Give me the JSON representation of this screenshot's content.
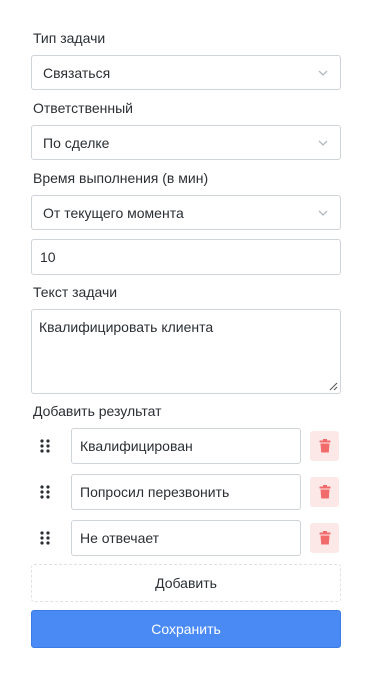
{
  "task_type": {
    "label": "Тип задачи",
    "value": "Связаться"
  },
  "responsible": {
    "label": "Ответственный",
    "value": "По сделке"
  },
  "due_time": {
    "label": "Время выполнения (в мин)",
    "mode": "От текущего момента",
    "minutes": "10"
  },
  "task_text": {
    "label": "Текст задачи",
    "value": "Квалифицировать клиента"
  },
  "results": {
    "label": "Добавить результат",
    "items": [
      {
        "value": "Квалифицирован"
      },
      {
        "value": "Попросил перезвонить"
      },
      {
        "value": "Не отвечает"
      }
    ]
  },
  "buttons": {
    "add": "Добавить",
    "save": "Сохранить"
  },
  "colors": {
    "primary": "#4a8af4",
    "delete_bg": "#fde8e8",
    "delete_icon": "#f26b6b",
    "border": "#cfd4d9"
  }
}
